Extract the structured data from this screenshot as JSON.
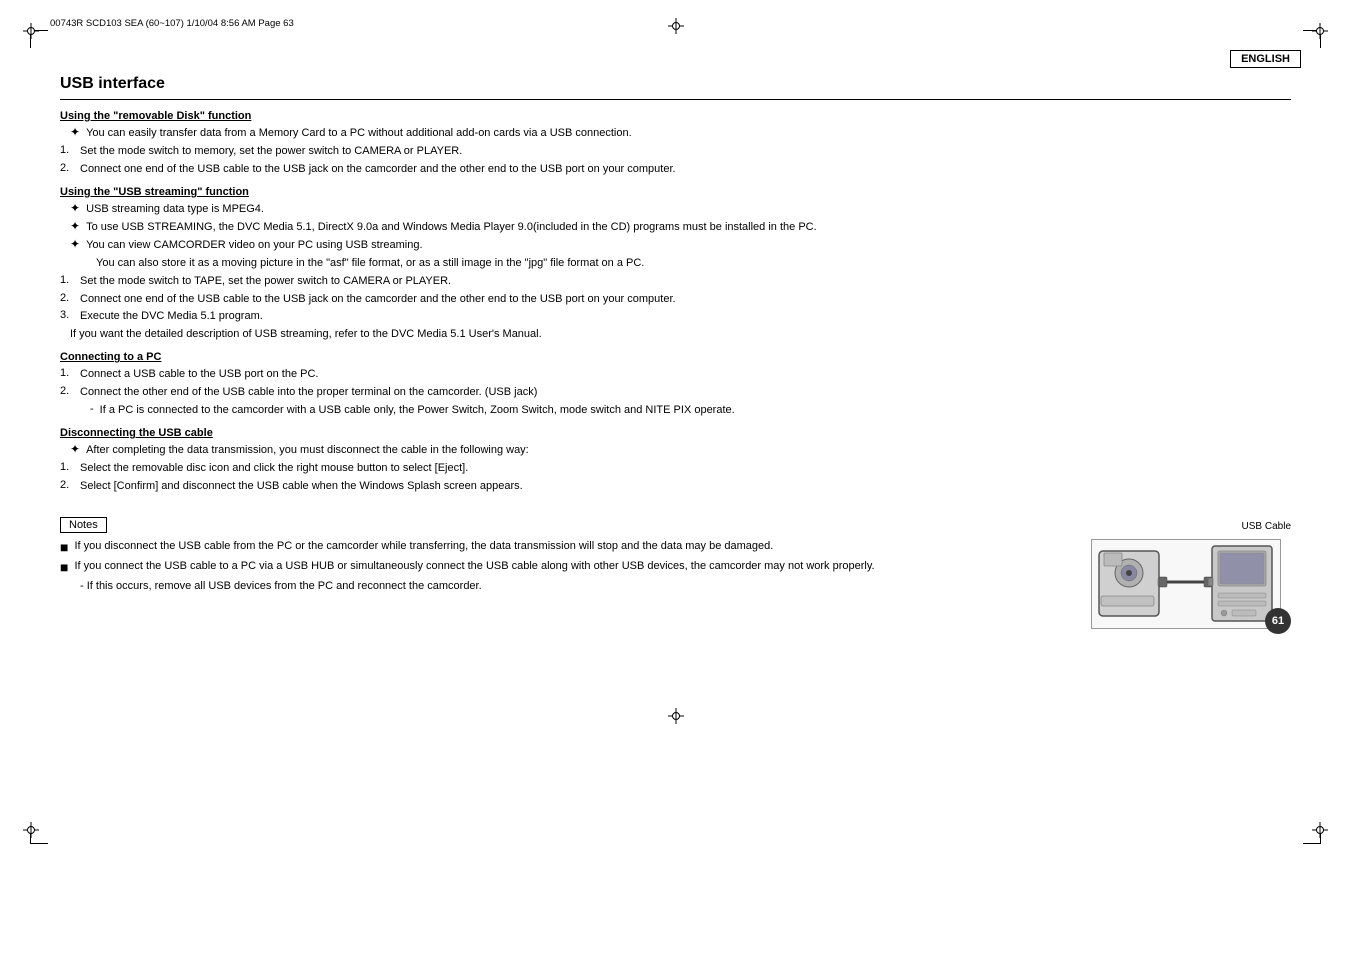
{
  "page": {
    "header_meta": "00743R SCD103 SEA (60~107)   1/10/04 8:56 AM   Page 63",
    "english_badge": "ENGLISH",
    "page_number": "61"
  },
  "title": "USB interface",
  "sections": [
    {
      "id": "removable-disk",
      "heading": "Using the \"removable Disk\" function",
      "bullets": [
        {
          "type": "cross",
          "text": "You can easily transfer data from a Memory Card to a PC without additional add-on cards via a USB connection."
        }
      ],
      "numbered": [
        {
          "num": "1.",
          "text": "Set the mode switch to memory, set the power switch to CAMERA or PLAYER."
        },
        {
          "num": "2.",
          "text": "Connect one end of the USB cable to the USB jack on the camcorder and the other end to the USB port on your computer."
        }
      ]
    },
    {
      "id": "usb-streaming",
      "heading": "Using the \"USB streaming\" function",
      "bullets": [
        {
          "type": "cross",
          "text": "USB streaming data type is MPEG4."
        },
        {
          "type": "cross",
          "text": "To use USB STREAMING, the DVC Media 5.1, DirectX 9.0a and Windows Media Player 9.0(included in the CD) programs must be installed in the PC."
        },
        {
          "type": "cross",
          "text": "You can view CAMCORDER video on your PC using USB streaming."
        },
        {
          "type": "indent",
          "text": "You can also store it as a moving picture in the \"asf\" file format, or as a still image in the \"jpg\" file format on a PC."
        }
      ],
      "numbered": [
        {
          "num": "1.",
          "text": "Set the mode switch to TAPE, set the power switch to CAMERA or PLAYER."
        },
        {
          "num": "2.",
          "text": "Connect one end of the USB cable to the USB jack on the camcorder and the other end to the USB port on your computer."
        },
        {
          "num": "3.",
          "text": "Execute the DVC Media 5.1 program."
        }
      ],
      "footer_note": "If you want the detailed description of USB streaming, refer to the DVC Media 5.1 User's Manual."
    },
    {
      "id": "connecting-pc",
      "heading": "Connecting to a PC",
      "numbered": [
        {
          "num": "1.",
          "text": "Connect a USB cable to the USB port on the PC."
        },
        {
          "num": "2.",
          "text": "Connect the other end of the USB cable into the proper terminal on the camcorder. (USB jack)"
        }
      ],
      "subitems": [
        {
          "dash": "-",
          "text": "If a PC is connected to the camcorder with a USB cable only, the Power Switch, Zoom Switch, mode switch and NITE PIX operate."
        }
      ]
    },
    {
      "id": "disconnecting",
      "heading": "Disconnecting the USB cable",
      "bullets": [
        {
          "type": "cross",
          "text": "After completing the data transmission, you must disconnect the cable in the following way:"
        }
      ],
      "numbered": [
        {
          "num": "1.",
          "text": "Select the removable disc icon and click the right mouse button to select [Eject]."
        },
        {
          "num": "2.",
          "text": "Select [Confirm] and disconnect the USB cable when the Windows Splash screen appears."
        }
      ]
    }
  ],
  "notes": {
    "label": "Notes",
    "items": [
      {
        "text": "If you disconnect the USB cable from the PC or the camcorder while transferring, the data transmission will stop and the data may be damaged."
      },
      {
        "text": "If you connect the USB cable to a PC via a USB HUB or simultaneously connect the USB cable along with other USB devices, the camcorder may not work properly."
      }
    ],
    "sub_item": "- If this occurs, remove all USB devices from the PC and reconnect the camcorder.",
    "diagram_label": "USB Cable"
  }
}
